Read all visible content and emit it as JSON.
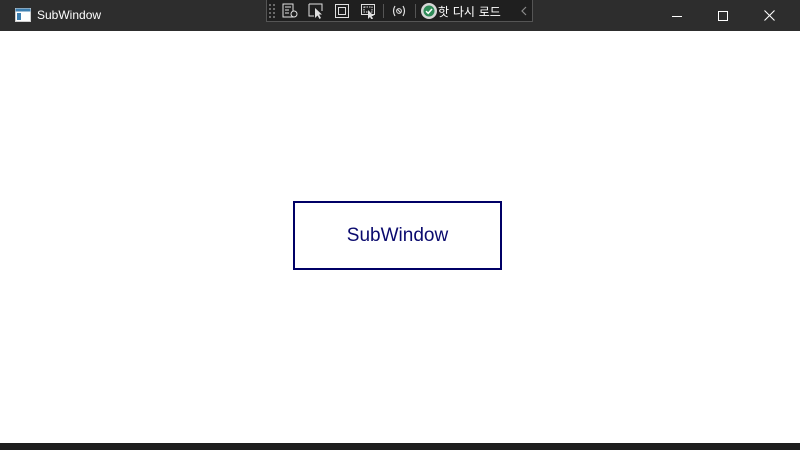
{
  "window": {
    "title": "SubWindow",
    "caption_buttons": [
      "minimize-icon",
      "maximize-icon",
      "close-icon"
    ]
  },
  "debug_toolbar": {
    "tools": [
      "live-visual-tree-icon",
      "select-element-icon",
      "display-layout-adorners-icon",
      "track-focus-icon",
      "binding-failures-icon"
    ],
    "hot_reload_label": "핫 다시 로드",
    "hot_reload_status_icon": "checkmark-icon"
  },
  "content": {
    "button_label": "SubWindow"
  },
  "colors": {
    "titlebar": "#2d2d2d",
    "button_border": "#000066",
    "button_text": "#0a0a6e"
  }
}
